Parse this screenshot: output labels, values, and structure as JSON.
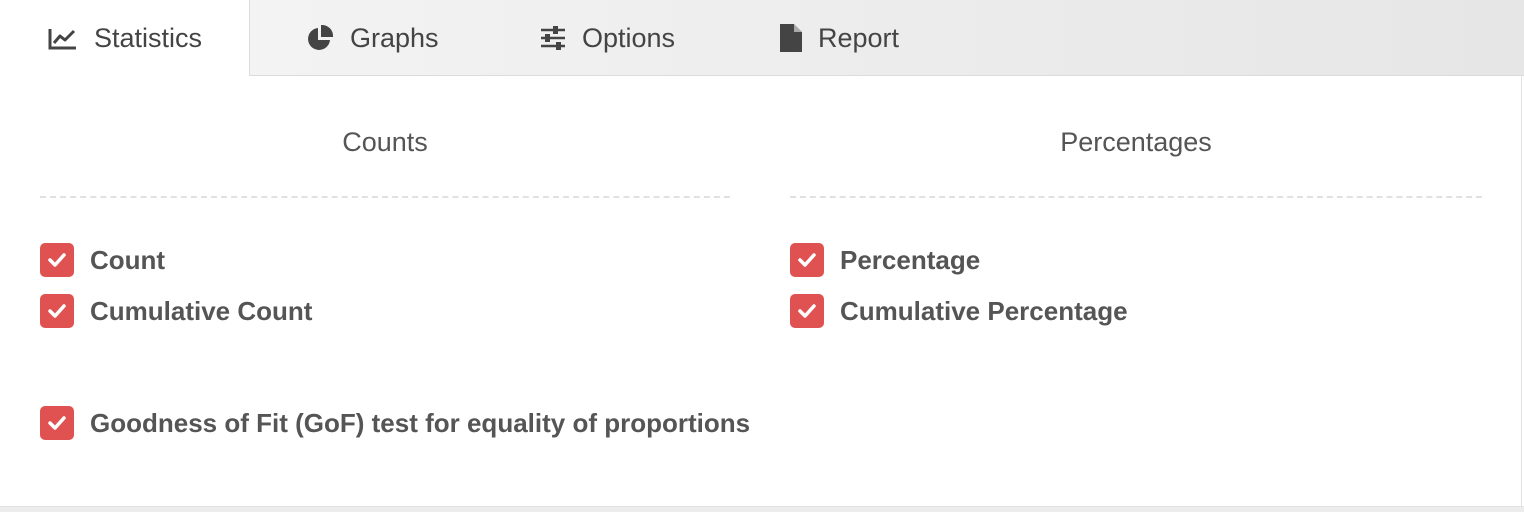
{
  "tabs": [
    {
      "label": "Statistics",
      "icon": "line-chart-icon",
      "active": true
    },
    {
      "label": "Graphs",
      "icon": "pie-chart-icon",
      "active": false
    },
    {
      "label": "Options",
      "icon": "sliders-icon",
      "active": false
    },
    {
      "label": "Report",
      "icon": "file-icon",
      "active": false
    }
  ],
  "counts": {
    "title": "Counts",
    "options": [
      {
        "label": "Count",
        "checked": true
      },
      {
        "label": "Cumulative Count",
        "checked": true
      }
    ]
  },
  "percentages": {
    "title": "Percentages",
    "options": [
      {
        "label": "Percentage",
        "checked": true
      },
      {
        "label": "Cumulative Percentage",
        "checked": true
      }
    ]
  },
  "gof": {
    "label": "Goodness of Fit (GoF) test for equality of proportions",
    "checked": true
  },
  "colors": {
    "accent": "#e05252",
    "text": "#555555",
    "tab_bg": "#ececec"
  }
}
